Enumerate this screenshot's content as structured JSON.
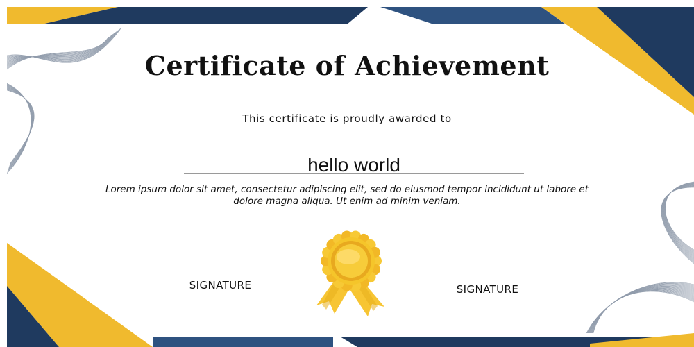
{
  "certificate": {
    "title": "Certificate of Achievement",
    "subtitle": "This certificate is proudly awarded to",
    "recipient_name": "hello world",
    "body": "Lorem ipsum dolor sit amet, consectetur adipiscing elit, sed do eiusmod tempor incididunt ut labore et dolore magna aliqua. Ut enim ad minim veniam.",
    "signature_left": "SIGNATURE",
    "signature_right": "SIGNATURE"
  },
  "colors": {
    "navy": "#1f3a5f",
    "gold": "#f0ba2e",
    "medal_gold": "#f5c52a"
  },
  "decorations": {
    "medal": "award-ribbon-icon",
    "waves": "line-wave-pattern"
  }
}
